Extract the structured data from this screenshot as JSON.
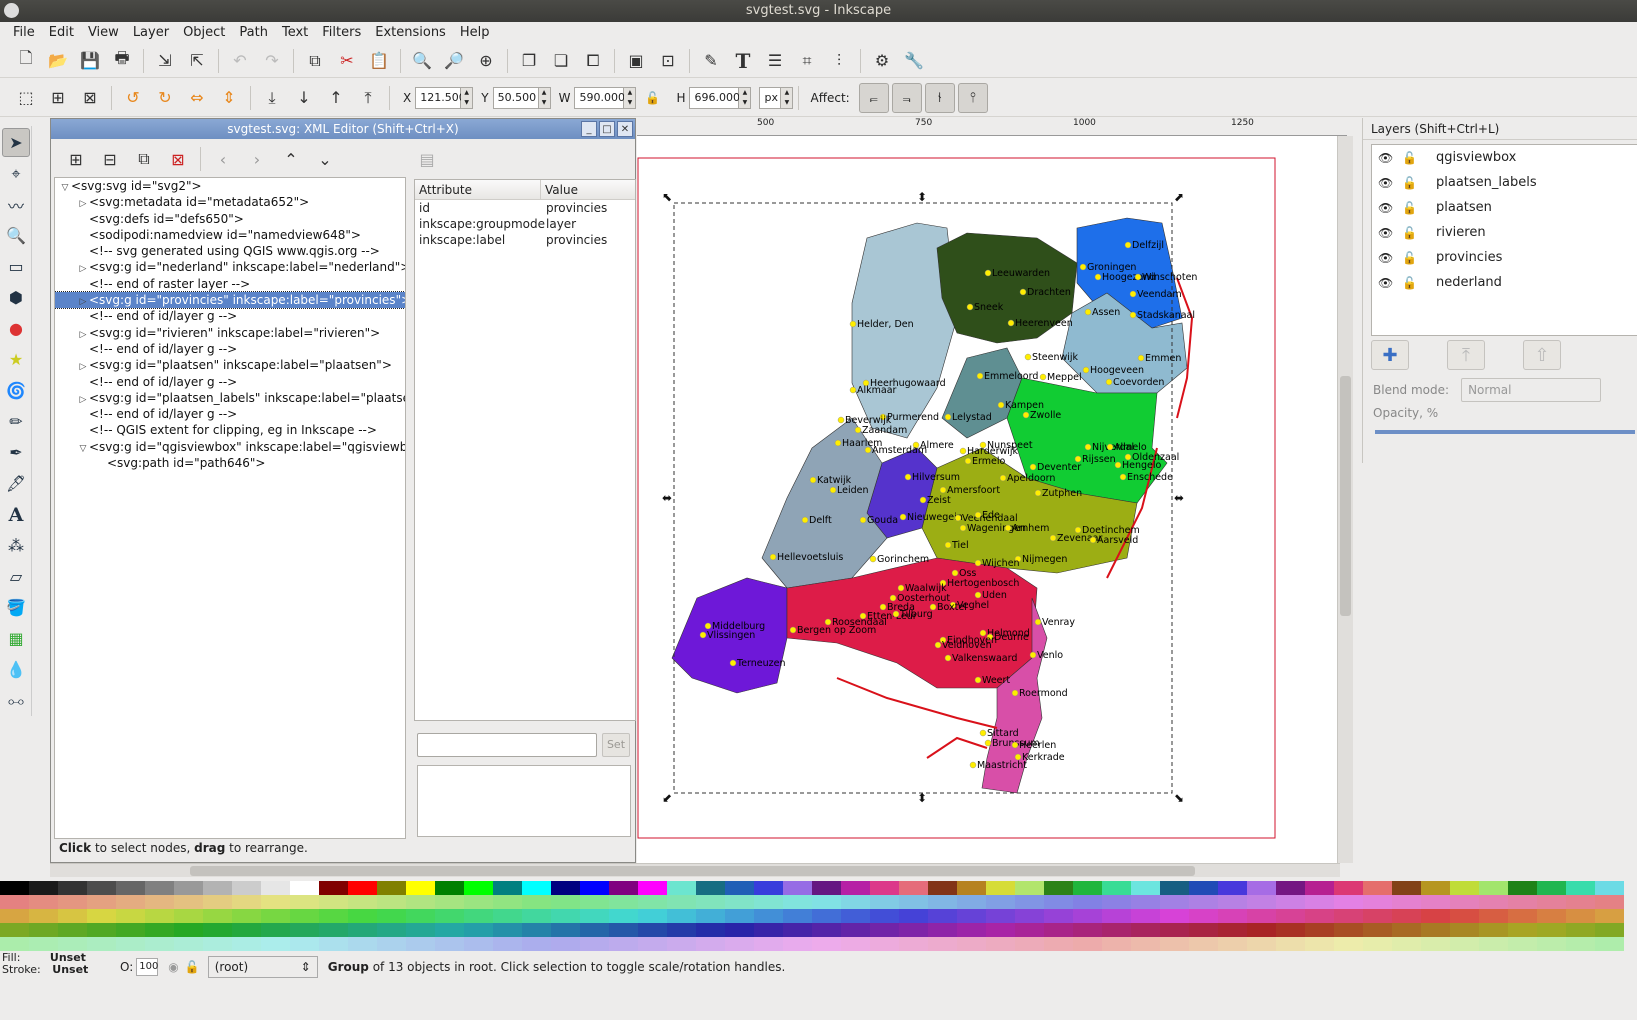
{
  "window_title": "svgtest.svg - Inkscape",
  "menu": [
    "File",
    "Edit",
    "View",
    "Layer",
    "Object",
    "Path",
    "Text",
    "Filters",
    "Extensions",
    "Help"
  ],
  "toolbar_controls": {
    "x_label": "X",
    "x_value": "121.500",
    "y_label": "Y",
    "y_value": "50.500",
    "w_label": "W",
    "w_value": "590.000",
    "h_label": "H",
    "h_value": "696.000",
    "unit": "px",
    "affect_label": "Affect:"
  },
  "xml_editor": {
    "title": "svgtest.svg: XML Editor (Shift+Ctrl+X)",
    "nodes": [
      {
        "indent": 0,
        "expander": "open",
        "text": "<svg:svg id=\"svg2\">"
      },
      {
        "indent": 1,
        "expander": "closed",
        "text": "<svg:metadata id=\"metadata652\">"
      },
      {
        "indent": 1,
        "expander": "none",
        "text": "<svg:defs id=\"defs650\">"
      },
      {
        "indent": 1,
        "expander": "none",
        "text": "<sodipodi:namedview id=\"namedview648\">"
      },
      {
        "indent": 1,
        "expander": "none",
        "text": "<!-- svg generated using QGIS www.qgis.org -->"
      },
      {
        "indent": 1,
        "expander": "closed",
        "text": "<svg:g id=\"nederland\" inkscape:label=\"nederland\">"
      },
      {
        "indent": 1,
        "expander": "none",
        "text": "<!-- end of raster layer -->"
      },
      {
        "indent": 1,
        "expander": "closed",
        "text": "<svg:g id=\"provincies\" inkscape:label=\"provincies\">",
        "selected": true
      },
      {
        "indent": 1,
        "expander": "none",
        "text": "<!-- end of id/layer g -->"
      },
      {
        "indent": 1,
        "expander": "closed",
        "text": "<svg:g id=\"rivieren\" inkscape:label=\"rivieren\">"
      },
      {
        "indent": 1,
        "expander": "none",
        "text": "<!-- end of id/layer g -->"
      },
      {
        "indent": 1,
        "expander": "closed",
        "text": "<svg:g id=\"plaatsen\" inkscape:label=\"plaatsen\">"
      },
      {
        "indent": 1,
        "expander": "none",
        "text": "<!-- end of id/layer g -->"
      },
      {
        "indent": 1,
        "expander": "closed",
        "text": "<svg:g id=\"plaatsen_labels\" inkscape:label=\"plaatsen_"
      },
      {
        "indent": 1,
        "expander": "none",
        "text": "<!-- end of id/layer g -->"
      },
      {
        "indent": 1,
        "expander": "none",
        "text": "<!-- QGIS extent for clipping, eg in Inkscape -->"
      },
      {
        "indent": 1,
        "expander": "open",
        "text": "<svg:g id=\"qgisviewbox\" inkscape:label=\"qgisviewbox"
      },
      {
        "indent": 2,
        "expander": "none",
        "text": "<svg:path id=\"path646\">"
      }
    ],
    "attr_header": {
      "attribute": "Attribute",
      "value": "Value"
    },
    "attributes": [
      {
        "name": "id",
        "value": "provincies"
      },
      {
        "name": "inkscape:groupmode",
        "value": "layer"
      },
      {
        "name": "inkscape:label",
        "value": "provincies"
      }
    ],
    "set_button": "Set",
    "status_bold1": "Click",
    "status_mid": " to select nodes, ",
    "status_bold2": "drag",
    "status_end": " to rearrange."
  },
  "ruler_ticks": [
    "500",
    "750",
    "1000",
    "1250"
  ],
  "map_labels": [
    {
      "t": "Delfzijl"
    },
    {
      "t": "Groningen"
    },
    {
      "t": "Hoogezand"
    },
    {
      "t": "Winschoten"
    },
    {
      "t": "Veendam"
    },
    {
      "t": "Leeuwarden"
    },
    {
      "t": "Drachten"
    },
    {
      "t": "Sneek"
    },
    {
      "t": "Heerenveen"
    },
    {
      "t": "Assen"
    },
    {
      "t": "Stadskanaal"
    },
    {
      "t": "Helder, Den"
    },
    {
      "t": "Steenwijk"
    },
    {
      "t": "Emmen"
    },
    {
      "t": "Hoogeveen"
    },
    {
      "t": "Coevorden"
    },
    {
      "t": "Emmeloord"
    },
    {
      "t": "Meppel"
    },
    {
      "t": "Heerhugowaard"
    },
    {
      "t": "Alkmaar"
    },
    {
      "t": "Kampen"
    },
    {
      "t": "Zwolle"
    },
    {
      "t": "Purmerend"
    },
    {
      "t": "Lelystad"
    },
    {
      "t": "Beverwijk"
    },
    {
      "t": "Zaandam"
    },
    {
      "t": "Haarlem"
    },
    {
      "t": "Almere"
    },
    {
      "t": "Amsterdam"
    },
    {
      "t": "Nunspeet"
    },
    {
      "t": "Harderwijk"
    },
    {
      "t": "Ermelo"
    },
    {
      "t": "Nijverdal"
    },
    {
      "t": "Almelo"
    },
    {
      "t": "Rijssen"
    },
    {
      "t": "Oldenzaal"
    },
    {
      "t": "Hengelo"
    },
    {
      "t": "Enschede"
    },
    {
      "t": "Hilversum"
    },
    {
      "t": "Deventer"
    },
    {
      "t": "Apeldoorn"
    },
    {
      "t": "Zutphen"
    },
    {
      "t": "Katwijk"
    },
    {
      "t": "Leiden"
    },
    {
      "t": "Amersfoort"
    },
    {
      "t": "Zeist"
    },
    {
      "t": "Gouda"
    },
    {
      "t": "Nieuwegein"
    },
    {
      "t": "Veenendaal"
    },
    {
      "t": "Ede"
    },
    {
      "t": "Delft"
    },
    {
      "t": "Wageningen"
    },
    {
      "t": "Arnhem"
    },
    {
      "t": "Doetinchem"
    },
    {
      "t": "Zevenaar"
    },
    {
      "t": "Aarsveld"
    },
    {
      "t": "Tiel"
    },
    {
      "t": "Hellevoetsluis"
    },
    {
      "t": "Gorinchem"
    },
    {
      "t": "Nijmegen"
    },
    {
      "t": "Wijchen"
    },
    {
      "t": "Oss"
    },
    {
      "t": "Hertogenbosch"
    },
    {
      "t": "Waalwijk"
    },
    {
      "t": "Oosterhout"
    },
    {
      "t": "Uden"
    },
    {
      "t": "Veghel"
    },
    {
      "t": "Breda"
    },
    {
      "t": "Etten-Leur"
    },
    {
      "t": "Boxtel"
    },
    {
      "t": "Tilburg"
    },
    {
      "t": "Roosendaal"
    },
    {
      "t": "Bergen op Zoom"
    },
    {
      "t": "Venray"
    },
    {
      "t": "Middelburg"
    },
    {
      "t": "Vlissingen"
    },
    {
      "t": "Helmond"
    },
    {
      "t": "Deurne"
    },
    {
      "t": "Eindhoven"
    },
    {
      "t": "Veldhoven"
    },
    {
      "t": "Valkenswaard"
    },
    {
      "t": "Terneuzen"
    },
    {
      "t": "Venlo"
    },
    {
      "t": "Weert"
    },
    {
      "t": "Roermond"
    },
    {
      "t": "Sittard"
    },
    {
      "t": "Brunssum"
    },
    {
      "t": "Heerlen"
    },
    {
      "t": "Kerkrade"
    },
    {
      "t": "Maastricht"
    }
  ],
  "layers_panel": {
    "title": "Layers (Shift+Ctrl+L)",
    "layers": [
      "qgisviewbox",
      "plaatsen_labels",
      "plaatsen",
      "rivieren",
      "provincies",
      "nederland"
    ],
    "blend_label": "Blend mode:",
    "blend_value": "Normal",
    "opacity_label": "Opacity, %"
  },
  "statusbar": {
    "fill_label": "Fill:",
    "fill_value": "Unset",
    "stroke_label": "Stroke:",
    "stroke_value": "Unset",
    "o_label": "O:",
    "o_value": "100",
    "layer_value": "(root)",
    "msg_bold": "Group",
    "msg_rest": " of 13 objects in root. Click selection to toggle scale/rotation handles."
  },
  "colors": {
    "selection_blue": "#5b84c9",
    "groningen": "#1e6fea",
    "friesland": "#2f4f1a",
    "drenthe": "#8fbad0",
    "overijssel": "#11cc33",
    "gelderland": "#9cae14",
    "utrecht": "#5533cc",
    "noordholland": "#a9c6d4",
    "zuidholland": "#8fa4b6",
    "zeeland": "#6e18d8",
    "noordbrabant": "#dd1c48",
    "limburg": "#d84fa8",
    "flevoland": "#5f8f92"
  }
}
